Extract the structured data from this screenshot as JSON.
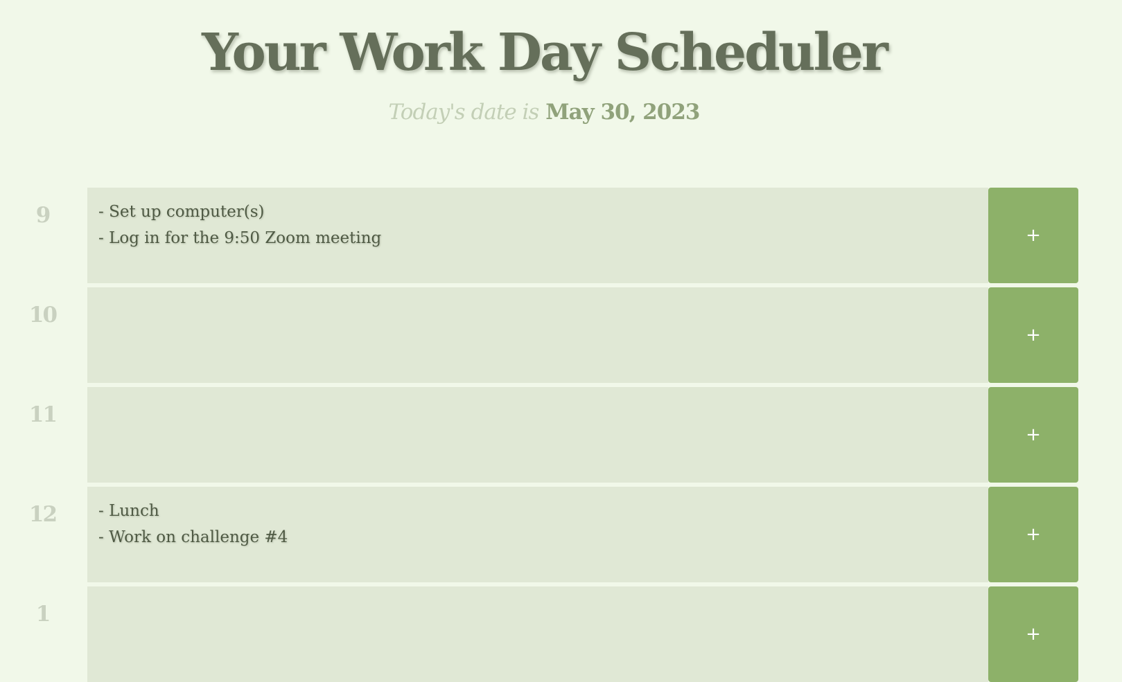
{
  "header": {
    "title": "Your Work Day Scheduler",
    "date_lead": "Today's date is",
    "date_value": "May 30, 2023"
  },
  "colors": {
    "background": "#f1f8e9",
    "title": "#656f5a",
    "hour_label": "#c9d1c0",
    "note_background": "#e0e8d5",
    "save_button": "#8db169"
  },
  "timeblocks": [
    {
      "hour": "9",
      "note": "- Set up computer(s)\n- Log in for the 9:50 Zoom meeting",
      "save_label": "+"
    },
    {
      "hour": "10",
      "note": "",
      "save_label": "+"
    },
    {
      "hour": "11",
      "note": "",
      "save_label": "+"
    },
    {
      "hour": "12",
      "note": "- Lunch\n- Work on challenge #4",
      "save_label": "+"
    },
    {
      "hour": "1",
      "note": "",
      "save_label": "+"
    }
  ]
}
